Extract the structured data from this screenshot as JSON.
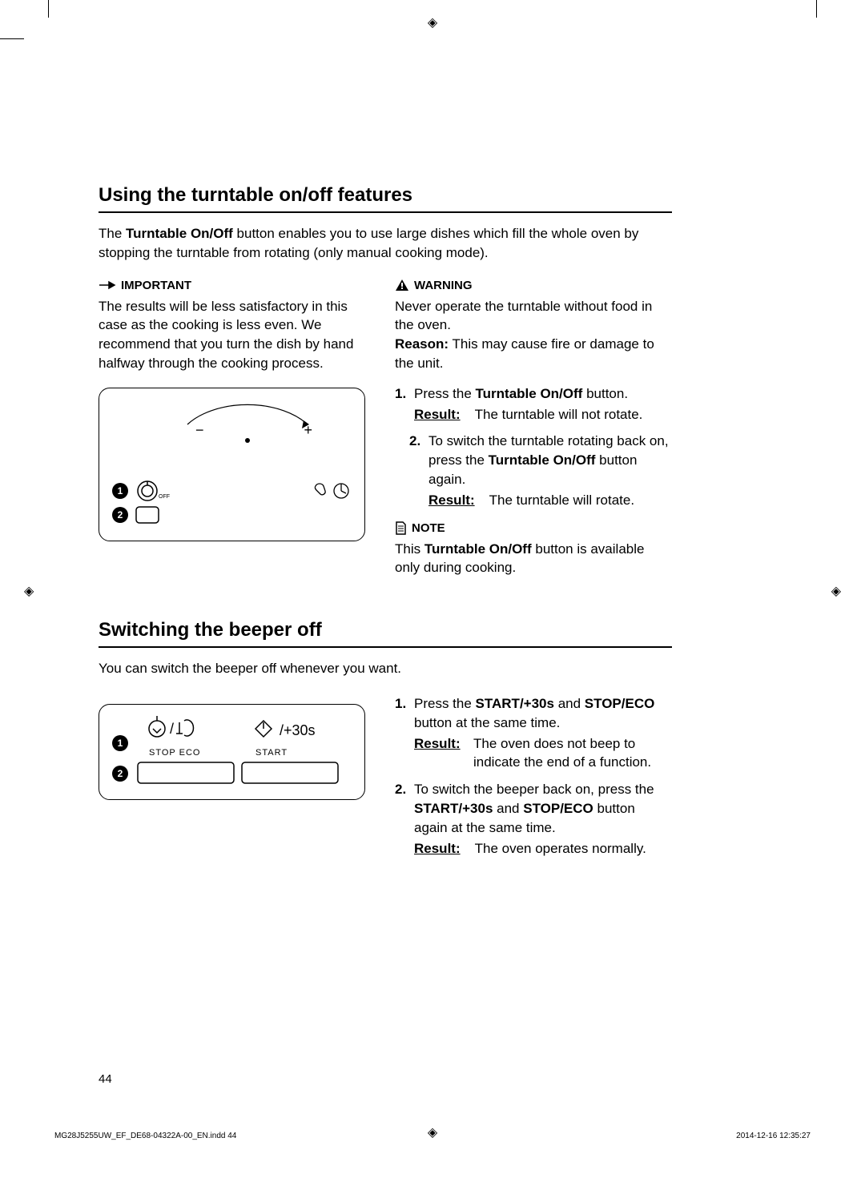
{
  "reg_mark": "◈",
  "section1": {
    "title": "Using the turntable on/off features",
    "intro_pre": "The ",
    "intro_bold": "Turntable On/Off",
    "intro_post": " button enables you to use large dishes which fill the whole oven by stopping the turntable from rotating (only manual cooking mode).",
    "important_label": "IMPORTANT",
    "important_body": "The results will be less satisfactory in this case as the cooking is less even. We recommend that you turn the dish by hand halfway through the cooking process.",
    "warning_label": "WARNING",
    "warning_pre": "Never operate the turntable without food in the oven.",
    "warning_reason_label": "Reason:",
    "warning_reason": " This may cause fire or damage to the unit.",
    "step1_num": "1.",
    "step1_pre": "Press the ",
    "step1_bold": "Turntable On/Off",
    "step1_post": " button.",
    "step1_result_label": "Result:",
    "step1_result": "The turntable will not rotate.",
    "step2_num": "2.",
    "step2_pre": "To switch the turntable rotating back on, press the ",
    "step2_bold": "Turntable On/Off",
    "step2_post": " button again.",
    "step2_result_label": "Result:",
    "step2_result": "The turntable will rotate.",
    "note_label": "NOTE",
    "note_pre": "This ",
    "note_bold": "Turntable On/Off",
    "note_post": " button is available only during cooking.",
    "ref1": "1",
    "ref2": "2",
    "off_label": "OFF",
    "minus": "−",
    "plus": "+"
  },
  "section2": {
    "title": "Switching the beeper off",
    "intro": "You can switch the beeper off whenever you want.",
    "stop_eco": "STOP  ECO",
    "start": "START",
    "plus30": "/+30s",
    "ref1": "1",
    "ref2": "2",
    "step1_num": "1.",
    "step1_pre": "Press the ",
    "step1_bold1": "START/+30s",
    "step1_and": " and ",
    "step1_bold2": "STOP/ECO",
    "step1_post": " button at the same time.",
    "step1_result_label": "Result:",
    "step1_result": "The oven does not beep to indicate the end of a function.",
    "step2_num": "2.",
    "step2_pre": "To switch the beeper back on, press the ",
    "step2_bold1": "START/+30s",
    "step2_and": " and ",
    "step2_bold2": "STOP/ECO",
    "step2_post": " button again at the same time.",
    "step2_result_label": "Result:",
    "step2_result": "The oven operates normally."
  },
  "page_number": "44",
  "footer": {
    "file": "MG28J5255UW_EF_DE68-04322A-00_EN.indd   44",
    "datetime": "2014-12-16   12:35:27"
  }
}
